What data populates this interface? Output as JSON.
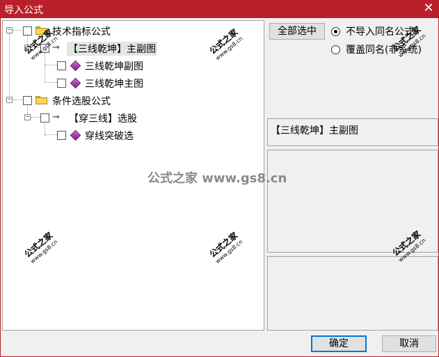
{
  "window": {
    "title": "导入公式",
    "close_glyph": "✕"
  },
  "tree": {
    "nodes": [
      {
        "label": "技术指标公式"
      },
      {
        "label": "【三线乾坤】主副图"
      },
      {
        "label": "三线乾坤副图"
      },
      {
        "label": "三线乾坤主图"
      },
      {
        "label": "条件选股公式"
      },
      {
        "label": "【穿三线】选股"
      },
      {
        "label": "穿线突破选"
      }
    ],
    "expander_symbol": "−"
  },
  "right_panel": {
    "select_all_label": "全部选中",
    "radio_options": [
      {
        "label": "不导入同名公式",
        "checked": true
      },
      {
        "label": "覆盖同名(非系统)",
        "checked": false
      }
    ],
    "selected_name": "【三线乾坤】主副图"
  },
  "footer": {
    "ok_label": "确定",
    "cancel_label": "取消"
  },
  "watermark": {
    "center_text": "公式之家 www.gs8.cn",
    "stamp_title": "公式之家",
    "stamp_url": "www.gs8.cn"
  },
  "colors": {
    "titlebar": "#b9202c",
    "folder": "#f7d65a",
    "gem": "#9b2ca8"
  },
  "icons": {
    "folder": "folder-icon",
    "formula": "formula-gem-icon",
    "key": "key-icon"
  }
}
